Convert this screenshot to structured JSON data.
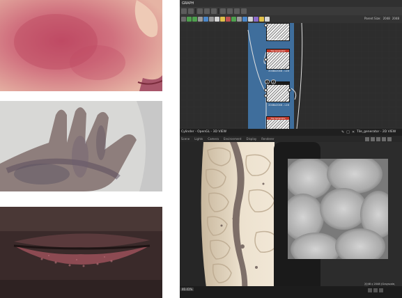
{
  "graph_panel": {
    "title": "GRAPH",
    "parent_size_label": "Parent Size:",
    "parent_size_value": "2048",
    "parent_size_value2": "2048"
  },
  "nodes": [
    {
      "header": "Tile Generator",
      "label": "2048x2048 - L16"
    },
    {
      "header": "Tile Generator",
      "label": "2048x2048 - L16"
    },
    {
      "header": "",
      "label": "2048x2048 - L16"
    },
    {
      "header": "Tile Generator",
      "label": ""
    }
  ],
  "viewport_3d": {
    "title": "Cylinder - OpenGL - 3D VIEW",
    "menu": [
      "Scene",
      "Lights",
      "Camera",
      "Environment",
      "Display",
      "Renderer"
    ]
  },
  "viewport_2d": {
    "title": "Tile_generator - 2D VIEW",
    "size_readout": "2048 x 2048 (Grayscale, 16bpc)",
    "zoom": "40.41%"
  },
  "icons": {
    "pin": "pin-icon",
    "close": "close-icon",
    "maximize": "maximize-icon",
    "badge": "number-badge-icon"
  },
  "colors": {
    "frame": "#3f6e9c",
    "node_header": "#c0392b",
    "app_bg": "#2a2a2a"
  }
}
